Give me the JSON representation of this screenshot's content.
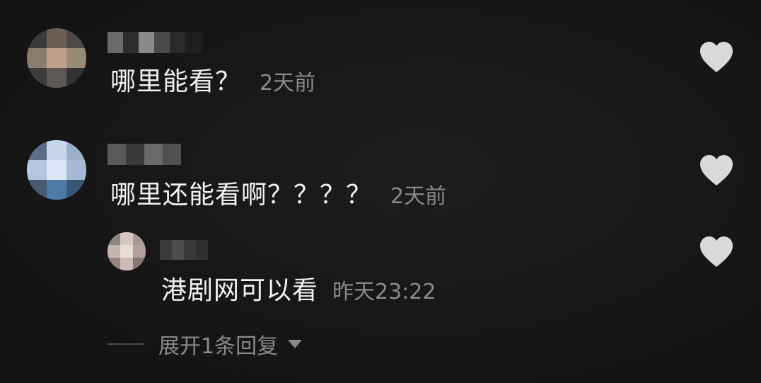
{
  "comments": [
    {
      "text": "哪里能看？",
      "time": "2天前",
      "icon": "heart-icon"
    },
    {
      "text": "哪里还能看啊？？？？",
      "time": "2天前",
      "icon": "heart-icon",
      "replies": [
        {
          "text": "港剧网可以看",
          "time": "昨天23:22",
          "icon": "heart-icon"
        }
      ],
      "expand_label": "展开1条回复"
    }
  ],
  "colors": {
    "background": "#161616",
    "text": "#f2f2f2",
    "meta": "#8a8a8a",
    "heart": "#d9d9d9"
  }
}
